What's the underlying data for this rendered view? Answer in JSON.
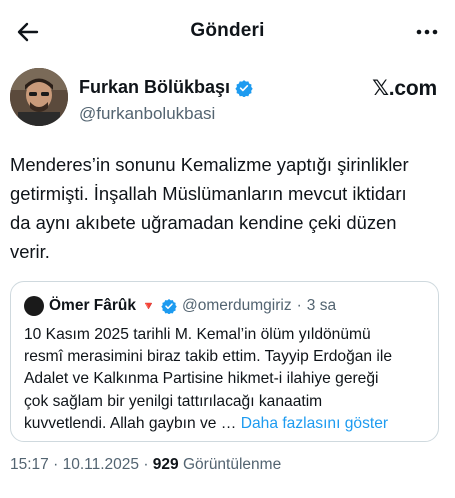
{
  "header": {
    "title": "Gönderi"
  },
  "author": {
    "name": "Furkan Bölükbaşı",
    "handle": "@furkanbolukbasi",
    "verified": true,
    "verified_color": "#1d9bf0"
  },
  "source": {
    "label": "𝕏.com"
  },
  "post": {
    "text": "Menderes’in sonunu Kemalizme yaptığı şirinlikler\ngetirmişti. İnşallah Müslümanların mevcut iktidarı\nda aynı akıbete uğramadan kendine çeki düzen\nverir."
  },
  "quote": {
    "name": "Ömer Fârûk",
    "flag": "🔻",
    "verified": true,
    "handle": "@omerdumgiriz",
    "separator": "·",
    "time": "3 sa",
    "text_lines": [
      "10 Kasım 2025 tarihli M. Kemal’in ölüm yıldönümü",
      "resmî merasimini biraz takib ettim. Tayyip Erdoğan ile",
      "Adalet ve Kalkınma Partisine hikmet-i ilahiye gereği",
      "çok sağlam bir yenilgi tattırılacağı kanaatim",
      "kuvvetlendi. Allah gaybın ve … "
    ],
    "more_label": "Daha fazlasını göster"
  },
  "meta": {
    "time": "15:17",
    "separator": " · ",
    "date": "10.11.2025",
    "views_count": "929",
    "views_label": " Görüntülenme"
  },
  "icons": {
    "back": "arrow-left-icon",
    "more": "more-horizontal-icon",
    "verified": "verified-badge-icon"
  }
}
